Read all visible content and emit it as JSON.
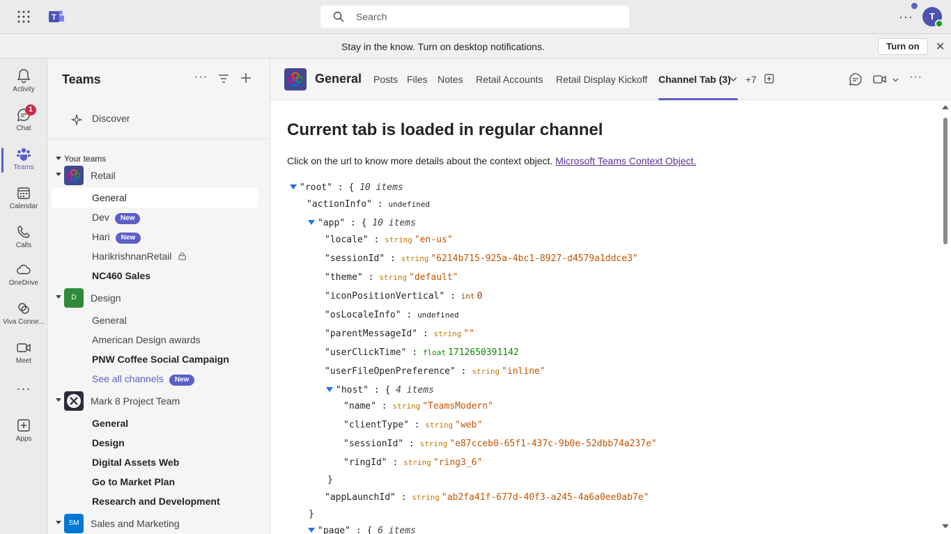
{
  "search": {
    "placeholder": "Search"
  },
  "user": {
    "initials": "T"
  },
  "banner": {
    "message": "Stay in the know. Turn on desktop notifications.",
    "button": "Turn on"
  },
  "rail": [
    {
      "label": "Activity",
      "icon": "bell-icon"
    },
    {
      "label": "Chat",
      "icon": "chat-icon",
      "badge": "1"
    },
    {
      "label": "Teams",
      "icon": "teams-icon"
    },
    {
      "label": "Calendar",
      "icon": "calendar-icon"
    },
    {
      "label": "Calls",
      "icon": "phone-icon"
    },
    {
      "label": "OneDrive",
      "icon": "cloud-icon"
    },
    {
      "label": "Viva Conne...",
      "icon": "viva-icon"
    },
    {
      "label": "Meet",
      "icon": "camera-icon"
    },
    {
      "label": "Apps",
      "icon": "add-apps-icon"
    }
  ],
  "panel": {
    "title": "Teams",
    "discover": "Discover",
    "your_teams": "Your teams",
    "new_badge": "New",
    "teams": [
      {
        "name": "Retail",
        "channels": [
          "General",
          "Dev",
          "Hari",
          "HarikrishnanRetail",
          "NC460 Sales"
        ]
      },
      {
        "name": "Design",
        "avatar": "D",
        "channels": [
          "General",
          "American Design awards",
          "PNW Coffee Social Campaign",
          "See all channels"
        ]
      },
      {
        "name": "Mark 8 Project Team",
        "channels": [
          "General",
          "Design",
          "Digital Assets Web",
          "Go to Market Plan",
          "Research and Development"
        ]
      },
      {
        "name": "Sales and Marketing",
        "avatar": "SM"
      }
    ]
  },
  "channel": {
    "name": "General",
    "tabs": [
      "Posts",
      "Files",
      "Notes",
      "Retail Accounts",
      "Retail Display Kickoff",
      "Channel Tab (3)",
      "+7"
    ]
  },
  "content": {
    "heading": "Current tab is loaded in regular channel",
    "intro": "Click on the url to know more details about the context object.",
    "link": "Microsoft Teams Context Object."
  },
  "json_tree": {
    "root": {
      "key": "\"root\"",
      "count": "10 items"
    },
    "actionInfo": {
      "key": "\"actionInfo\"",
      "value": "undefined"
    },
    "app": {
      "key": "\"app\"",
      "count": "10 items"
    },
    "locale": {
      "key": "\"locale\"",
      "type": "string",
      "value": "\"en-us\""
    },
    "sessionId": {
      "key": "\"sessionId\"",
      "type": "string",
      "value": "\"6214b715-925a-4bc1-8927-d4579a1ddce3\""
    },
    "theme": {
      "key": "\"theme\"",
      "type": "string",
      "value": "\"default\""
    },
    "iconPositionVertical": {
      "key": "\"iconPositionVertical\"",
      "type": "int",
      "value": "0"
    },
    "osLocaleInfo": {
      "key": "\"osLocaleInfo\"",
      "value": "undefined"
    },
    "parentMessageId": {
      "key": "\"parentMessageId\"",
      "type": "string",
      "value": "\"\""
    },
    "userClickTime": {
      "key": "\"userClickTime\"",
      "type": "float",
      "value": "1712650391142"
    },
    "userFileOpenPreference": {
      "key": "\"userFileOpenPreference\"",
      "type": "string",
      "value": "\"inline\""
    },
    "host": {
      "key": "\"host\"",
      "count": "4 items"
    },
    "host_name": {
      "key": "\"name\"",
      "type": "string",
      "value": "\"TeamsModern\""
    },
    "host_clientType": {
      "key": "\"clientType\"",
      "type": "string",
      "value": "\"web\""
    },
    "host_sessionId": {
      "key": "\"sessionId\"",
      "type": "string",
      "value": "\"e87cceb0-65f1-437c-9b0e-52dbb74a237e\""
    },
    "host_ringId": {
      "key": "\"ringId\"",
      "type": "string",
      "value": "\"ring3_6\""
    },
    "appLaunchId": {
      "key": "\"appLaunchId\"",
      "type": "string",
      "value": "\"ab2fa41f-677d-40f3-a245-4a6a0ee0ab7e\""
    },
    "page": {
      "key": "\"page\"",
      "count": "6 items"
    }
  }
}
